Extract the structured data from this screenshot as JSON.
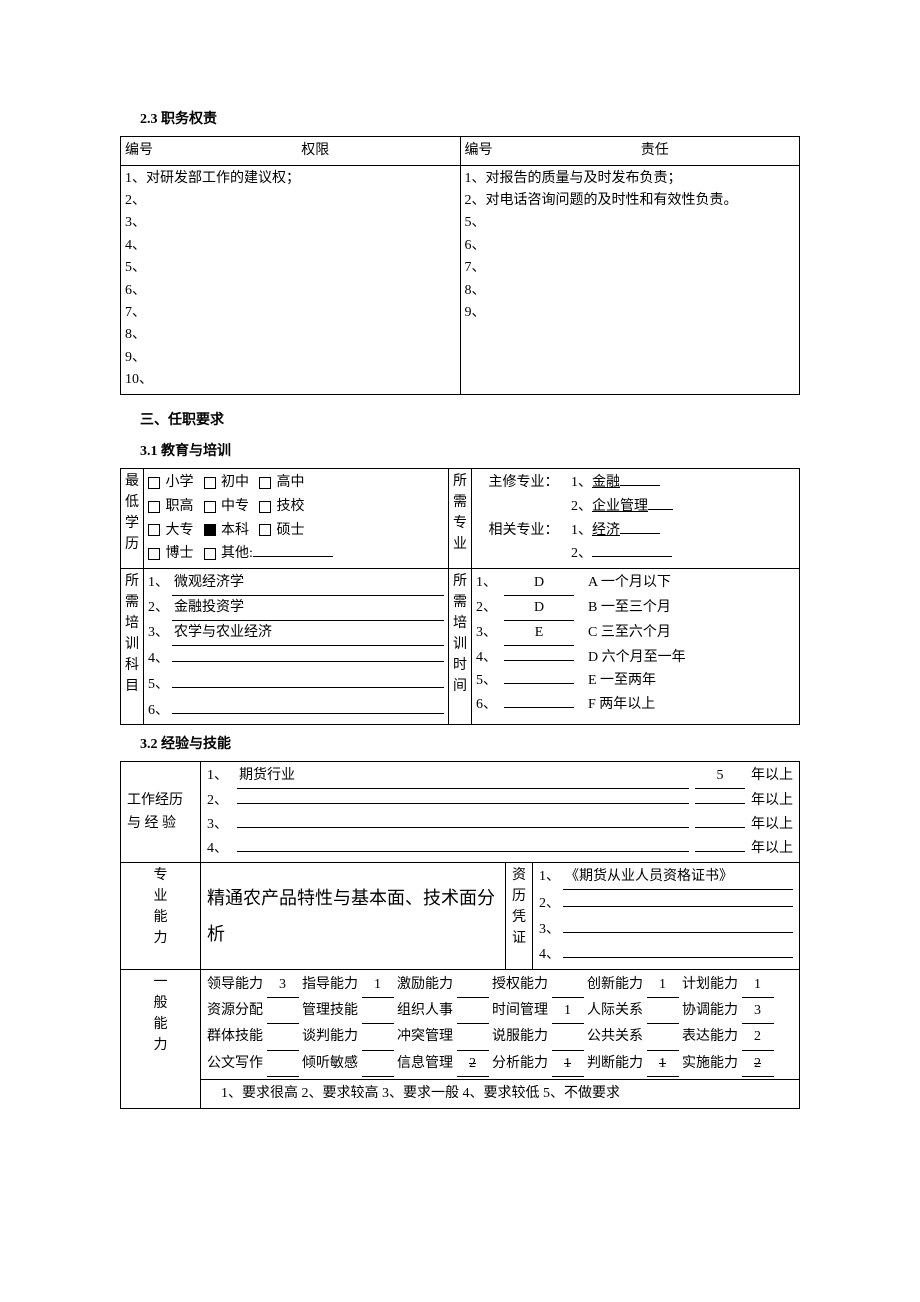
{
  "s23": {
    "title": "2.3  职务权责",
    "left_header_num": "编号",
    "left_header": "权限",
    "right_header_num": "编号",
    "right_header": "责任",
    "left": [
      "1、对研发部工作的建议权；",
      "2、",
      "3、",
      "4、",
      "5、",
      "6、",
      "7、",
      "8、",
      "9、",
      "10、"
    ],
    "right": [
      "1、对报告的质量与及时发布负责；",
      "2、对电话咨询问题的及时性和有效性负责。",
      "5、",
      "6、",
      "7、",
      "8、",
      "9、"
    ]
  },
  "s3": {
    "title": "三、任职要求"
  },
  "s31": {
    "title": "3.1  教育与培训",
    "edu_label": "最低学历",
    "major_label": "所需专业",
    "edu_rows": [
      [
        {
          "t": "小学",
          "f": false
        },
        {
          "t": "初中",
          "f": false
        },
        {
          "t": "高中",
          "f": false
        }
      ],
      [
        {
          "t": "职高",
          "f": false
        },
        {
          "t": "中专",
          "f": false
        },
        {
          "t": "技校",
          "f": false
        }
      ],
      [
        {
          "t": "大专",
          "f": false
        },
        {
          "t": "本科",
          "f": true
        },
        {
          "t": "硕士",
          "f": false
        }
      ],
      [
        {
          "t": "博士",
          "f": false
        },
        {
          "t": "其他:",
          "f": false
        }
      ]
    ],
    "major_main_label": "主修专业：",
    "major_rel_label": "相关专业：",
    "majors_main": [
      "金融",
      "企业管理"
    ],
    "majors_rel": [
      "经济",
      ""
    ],
    "subj_label": "所需培训科目",
    "time_label": "所需培训时间",
    "subjects": [
      "微观经济学",
      "金融投资学",
      "农学与农业经济",
      "",
      "",
      ""
    ],
    "training_vals": [
      "D",
      "D",
      "E",
      "",
      "",
      ""
    ],
    "training_opts": [
      "A 一个月以下",
      "B 一至三个月",
      "C 三至六个月",
      "D 六个月至一年",
      "E 一至两年",
      "F 两年以上"
    ]
  },
  "s32": {
    "title": "3.2  经验与技能",
    "exp_label": "工作经历与 经 验",
    "exp_rows": [
      {
        "t": "期货行业",
        "y": "5"
      },
      {
        "t": "",
        "y": ""
      },
      {
        "t": "",
        "y": ""
      },
      {
        "t": "",
        "y": ""
      }
    ],
    "year_suffix": "年以上",
    "pro_label": "专业能力",
    "pro_text": "精通农产品特性与基本面、技术面分析",
    "cert_label": "资历凭证",
    "certs": [
      "《期货从业人员资格证书》",
      "",
      "",
      ""
    ],
    "gen_label": "一般能力",
    "skills": [
      [
        {
          "n": "领导能力",
          "v": "3"
        },
        {
          "n": "指导能力",
          "v": "1"
        },
        {
          "n": "激励能力",
          "v": ""
        },
        {
          "n": "授权能力",
          "v": ""
        },
        {
          "n": "创新能力",
          "v": "1"
        },
        {
          "n": "计划能力",
          "v": "1"
        }
      ],
      [
        {
          "n": "资源分配",
          "v": ""
        },
        {
          "n": "管理技能",
          "v": ""
        },
        {
          "n": "组织人事",
          "v": ""
        },
        {
          "n": "时间管理",
          "v": "1"
        },
        {
          "n": "人际关系",
          "v": ""
        },
        {
          "n": "协调能力",
          "v": "3"
        }
      ],
      [
        {
          "n": "群体技能",
          "v": ""
        },
        {
          "n": "谈判能力",
          "v": ""
        },
        {
          "n": "冲突管理",
          "v": ""
        },
        {
          "n": "说服能力",
          "v": ""
        },
        {
          "n": "公共关系",
          "v": ""
        },
        {
          "n": "表达能力",
          "v": "2"
        }
      ],
      [
        {
          "n": "公文写作",
          "v": ""
        },
        {
          "n": "倾听敏感",
          "v": ""
        },
        {
          "n": "信息管理",
          "v": "2",
          "strike": true
        },
        {
          "n": "分析能力",
          "v": "1",
          "strike": true
        },
        {
          "n": "判断能力",
          "v": "1",
          "strike": true
        },
        {
          "n": "实施能力",
          "v": "2",
          "strike": true
        }
      ]
    ],
    "legend": "1、要求很高    2、要求较高       3、要求一般       4、要求较低       5、不做要求"
  }
}
